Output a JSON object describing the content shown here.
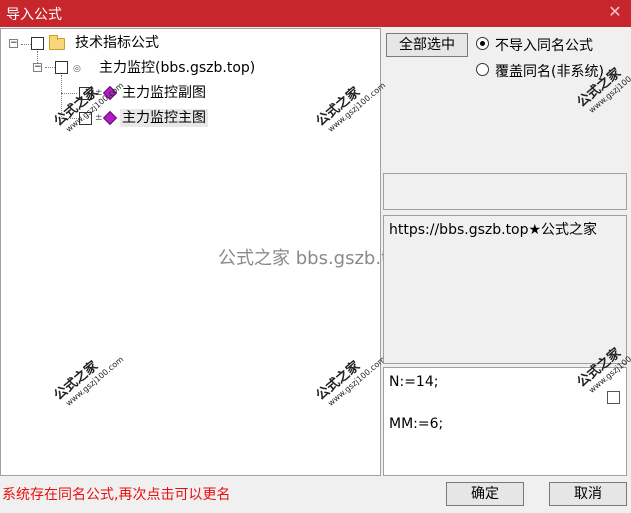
{
  "window": {
    "title": "导入公式",
    "close_glyph": "✕"
  },
  "tree": {
    "root": {
      "label": "技术指标公式",
      "expander": "−"
    },
    "group": {
      "label": "主力监控(bbs.gszb.top)",
      "expander": "−"
    },
    "items": [
      {
        "label": "主力监控副图"
      },
      {
        "label": "主力监控主图"
      }
    ]
  },
  "watermark": {
    "title": "公式之家",
    "url": "www.gszj100.com"
  },
  "center_watermark": "公式之家 bbs.gszb.top",
  "options": {
    "select_all_label": "全部选中",
    "radio_no_import": "不导入同名公式",
    "radio_overwrite": "覆盖同名(非系统)",
    "selected": "radio_no_import"
  },
  "description": "https://bbs.gszb.top★公式之家",
  "params": {
    "line1": "N:=14;",
    "line2": "MM:=6;"
  },
  "status": "系统存在同名公式,再次点击可以更名",
  "buttons": {
    "ok": "确定",
    "cancel": "取消"
  }
}
